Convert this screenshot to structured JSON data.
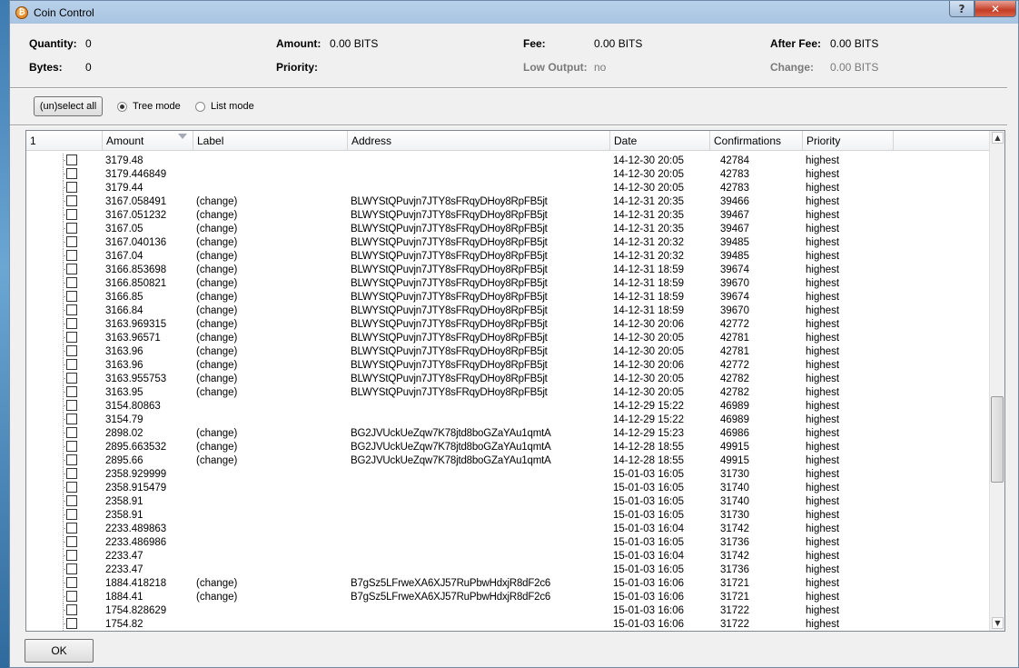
{
  "window": {
    "title": "Coin Control"
  },
  "summary": {
    "quantity_label": "Quantity:",
    "quantity_value": "0",
    "bytes_label": "Bytes:",
    "bytes_value": "0",
    "amount_label": "Amount:",
    "amount_value": "0.00 BITS",
    "priority_label": "Priority:",
    "priority_value": "",
    "fee_label": "Fee:",
    "fee_value": "0.00 BITS",
    "low_output_label": "Low Output:",
    "low_output_value": "no",
    "after_fee_label": "After Fee:",
    "after_fee_value": "0.00 BITS",
    "change_label": "Change:",
    "change_value": "0.00 BITS"
  },
  "toolbar": {
    "select_all_label": "(un)select all",
    "tree_mode_label": "Tree mode",
    "list_mode_label": "List mode",
    "mode_selected": "tree"
  },
  "columns": [
    "1",
    "Amount",
    "Label",
    "Address",
    "Date",
    "Confirmations",
    "Priority"
  ],
  "rows": [
    {
      "amount": "3179.48",
      "label": "",
      "address": "",
      "date": "14-12-30 20:05",
      "confirmations": "42784",
      "priority": "highest"
    },
    {
      "amount": "3179.446849",
      "label": "",
      "address": "",
      "date": "14-12-30 20:05",
      "confirmations": "42783",
      "priority": "highest"
    },
    {
      "amount": "3179.44",
      "label": "",
      "address": "",
      "date": "14-12-30 20:05",
      "confirmations": "42783",
      "priority": "highest"
    },
    {
      "amount": "3167.058491",
      "label": "(change)",
      "address": "BLWYStQPuvjn7JTY8sFRqyDHoy8RpFB5jt",
      "date": "14-12-31 20:35",
      "confirmations": "39466",
      "priority": "highest"
    },
    {
      "amount": "3167.051232",
      "label": "(change)",
      "address": "BLWYStQPuvjn7JTY8sFRqyDHoy8RpFB5jt",
      "date": "14-12-31 20:35",
      "confirmations": "39467",
      "priority": "highest"
    },
    {
      "amount": "3167.05",
      "label": "(change)",
      "address": "BLWYStQPuvjn7JTY8sFRqyDHoy8RpFB5jt",
      "date": "14-12-31 20:35",
      "confirmations": "39467",
      "priority": "highest"
    },
    {
      "amount": "3167.040136",
      "label": "(change)",
      "address": "BLWYStQPuvjn7JTY8sFRqyDHoy8RpFB5jt",
      "date": "14-12-31 20:32",
      "confirmations": "39485",
      "priority": "highest"
    },
    {
      "amount": "3167.04",
      "label": "(change)",
      "address": "BLWYStQPuvjn7JTY8sFRqyDHoy8RpFB5jt",
      "date": "14-12-31 20:32",
      "confirmations": "39485",
      "priority": "highest"
    },
    {
      "amount": "3166.853698",
      "label": "(change)",
      "address": "BLWYStQPuvjn7JTY8sFRqyDHoy8RpFB5jt",
      "date": "14-12-31 18:59",
      "confirmations": "39674",
      "priority": "highest"
    },
    {
      "amount": "3166.850821",
      "label": "(change)",
      "address": "BLWYStQPuvjn7JTY8sFRqyDHoy8RpFB5jt",
      "date": "14-12-31 18:59",
      "confirmations": "39670",
      "priority": "highest"
    },
    {
      "amount": "3166.85",
      "label": "(change)",
      "address": "BLWYStQPuvjn7JTY8sFRqyDHoy8RpFB5jt",
      "date": "14-12-31 18:59",
      "confirmations": "39674",
      "priority": "highest"
    },
    {
      "amount": "3166.84",
      "label": "(change)",
      "address": "BLWYStQPuvjn7JTY8sFRqyDHoy8RpFB5jt",
      "date": "14-12-31 18:59",
      "confirmations": "39670",
      "priority": "highest"
    },
    {
      "amount": "3163.969315",
      "label": "(change)",
      "address": "BLWYStQPuvjn7JTY8sFRqyDHoy8RpFB5jt",
      "date": "14-12-30 20:06",
      "confirmations": "42772",
      "priority": "highest"
    },
    {
      "amount": "3163.96571",
      "label": "(change)",
      "address": "BLWYStQPuvjn7JTY8sFRqyDHoy8RpFB5jt",
      "date": "14-12-30 20:05",
      "confirmations": "42781",
      "priority": "highest"
    },
    {
      "amount": "3163.96",
      "label": "(change)",
      "address": "BLWYStQPuvjn7JTY8sFRqyDHoy8RpFB5jt",
      "date": "14-12-30 20:05",
      "confirmations": "42781",
      "priority": "highest"
    },
    {
      "amount": "3163.96",
      "label": "(change)",
      "address": "BLWYStQPuvjn7JTY8sFRqyDHoy8RpFB5jt",
      "date": "14-12-30 20:06",
      "confirmations": "42772",
      "priority": "highest"
    },
    {
      "amount": "3163.955753",
      "label": "(change)",
      "address": "BLWYStQPuvjn7JTY8sFRqyDHoy8RpFB5jt",
      "date": "14-12-30 20:05",
      "confirmations": "42782",
      "priority": "highest"
    },
    {
      "amount": "3163.95",
      "label": "(change)",
      "address": "BLWYStQPuvjn7JTY8sFRqyDHoy8RpFB5jt",
      "date": "14-12-30 20:05",
      "confirmations": "42782",
      "priority": "highest"
    },
    {
      "amount": "3154.80863",
      "label": "",
      "address": "",
      "date": "14-12-29 15:22",
      "confirmations": "46989",
      "priority": "highest"
    },
    {
      "amount": "3154.79",
      "label": "",
      "address": "",
      "date": "14-12-29 15:22",
      "confirmations": "46989",
      "priority": "highest"
    },
    {
      "amount": "2898.02",
      "label": "(change)",
      "address": "BG2JVUckUeZqw7K78jtd8boGZaYAu1qmtA",
      "date": "14-12-29 15:23",
      "confirmations": "46986",
      "priority": "highest"
    },
    {
      "amount": "2895.663532",
      "label": "(change)",
      "address": "BG2JVUckUeZqw7K78jtd8boGZaYAu1qmtA",
      "date": "14-12-28 18:55",
      "confirmations": "49915",
      "priority": "highest"
    },
    {
      "amount": "2895.66",
      "label": "(change)",
      "address": "BG2JVUckUeZqw7K78jtd8boGZaYAu1qmtA",
      "date": "14-12-28 18:55",
      "confirmations": "49915",
      "priority": "highest"
    },
    {
      "amount": "2358.929999",
      "label": "",
      "address": "",
      "date": "15-01-03 16:05",
      "confirmations": "31730",
      "priority": "highest"
    },
    {
      "amount": "2358.915479",
      "label": "",
      "address": "",
      "date": "15-01-03 16:05",
      "confirmations": "31740",
      "priority": "highest"
    },
    {
      "amount": "2358.91",
      "label": "",
      "address": "",
      "date": "15-01-03 16:05",
      "confirmations": "31740",
      "priority": "highest"
    },
    {
      "amount": "2358.91",
      "label": "",
      "address": "",
      "date": "15-01-03 16:05",
      "confirmations": "31730",
      "priority": "highest"
    },
    {
      "amount": "2233.489863",
      "label": "",
      "address": "",
      "date": "15-01-03 16:04",
      "confirmations": "31742",
      "priority": "highest"
    },
    {
      "amount": "2233.486986",
      "label": "",
      "address": "",
      "date": "15-01-03 16:05",
      "confirmations": "31736",
      "priority": "highest"
    },
    {
      "amount": "2233.47",
      "label": "",
      "address": "",
      "date": "15-01-03 16:04",
      "confirmations": "31742",
      "priority": "highest"
    },
    {
      "amount": "2233.47",
      "label": "",
      "address": "",
      "date": "15-01-03 16:05",
      "confirmations": "31736",
      "priority": "highest"
    },
    {
      "amount": "1884.418218",
      "label": "(change)",
      "address": "B7gSz5LFrweXA6XJ57RuPbwHdxjR8dF2c6",
      "date": "15-01-03 16:06",
      "confirmations": "31721",
      "priority": "highest"
    },
    {
      "amount": "1884.41",
      "label": "(change)",
      "address": "B7gSz5LFrweXA6XJ57RuPbwHdxjR8dF2c6",
      "date": "15-01-03 16:06",
      "confirmations": "31721",
      "priority": "highest"
    },
    {
      "amount": "1754.828629",
      "label": "",
      "address": "",
      "date": "15-01-03 16:06",
      "confirmations": "31722",
      "priority": "highest"
    },
    {
      "amount": "1754.82",
      "label": "",
      "address": "",
      "date": "15-01-03 16:06",
      "confirmations": "31722",
      "priority": "highest"
    }
  ],
  "footer": {
    "ok_label": "OK"
  }
}
